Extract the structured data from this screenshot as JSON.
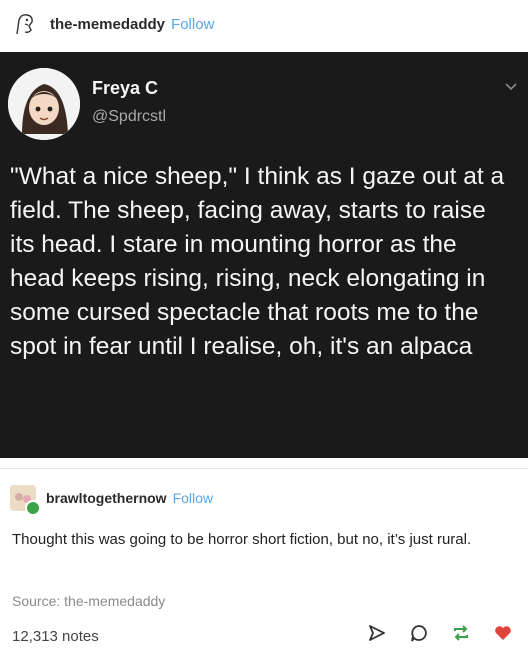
{
  "post": {
    "username": "the-memedaddy",
    "follow_label": "Follow"
  },
  "tweet": {
    "name": "Freya C",
    "handle": "@Spdrcstl",
    "text": "\"What a nice sheep,\" I think as I gaze out at a field. The sheep, facing away, starts to raise its head. I stare in mounting horror as the head keeps rising, rising, neck elongating in some cursed spectacle that roots me to the spot in fear until I realise, oh, it's an alpaca"
  },
  "reblog": {
    "username": "brawltogethernow",
    "follow_label": "Follow",
    "body": "Thought this was going to be horror short fiction, but no, it’s just rural."
  },
  "footer": {
    "source": "Source: the-memedaddy",
    "notes": "12,313 notes"
  },
  "icons": {
    "share": "send-icon",
    "reply": "reply-icon",
    "reblog": "reblog-icon",
    "like": "heart-icon"
  },
  "colors": {
    "follow": "#5aa7e8",
    "tweet_bg": "#1a1a1a",
    "reblog_green": "#3fa14a",
    "heart_red": "#e0453c"
  }
}
